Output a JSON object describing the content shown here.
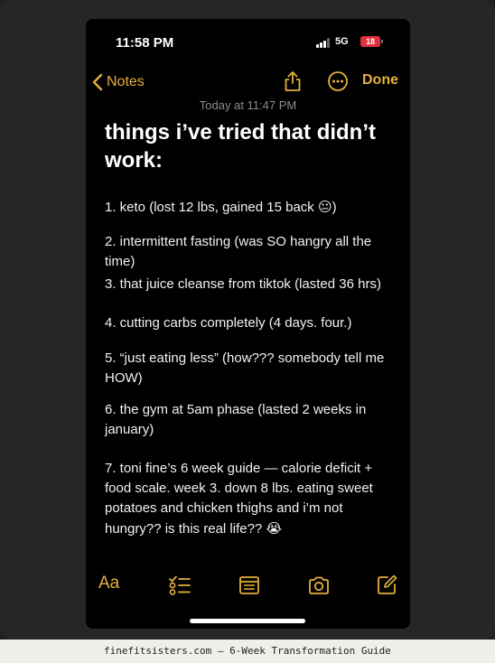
{
  "status_bar": {
    "time": "11:58 PM",
    "network": "5G",
    "battery": "18"
  },
  "nav": {
    "back_label": "Notes",
    "done_label": "Done"
  },
  "note": {
    "timestamp": "Today at 11:47 PM",
    "title": "things i’ve tried that didn’t work:",
    "items": [
      {
        "text": "1. keto (lost 12 lbs, gained 15 back ",
        "emoji": "😐",
        "tail": ")"
      },
      {
        "text": "2. intermittent fasting (was SO hangry all the time)"
      },
      {
        "text": "3. that juice cleanse from tiktok (lasted 36 hrs)"
      },
      {
        "text": "4. cutting carbs completely (4 days. four.)"
      },
      {
        "text": "5. “just eating less” (how??? somebody tell me HOW)"
      },
      {
        "text": "6. the gym at 5am phase (lasted 2 weeks in january)"
      },
      {
        "text": "7. toni fine’s 6 week guide — calorie deficit + food scale. week 3. down 8 lbs. eating sweet potatoes and chicken thighs and i’m not hungry?? is this real life?? ",
        "emoji": "😭"
      }
    ]
  },
  "toolbar": {
    "format_label": "Aa"
  },
  "caption": "finefitsisters.com — 6-Week Transformation Guide",
  "colors": {
    "accent": "#e5b03c",
    "background": "#000000",
    "battery": "#e0323c"
  },
  "icons": [
    "back-chevron-icon",
    "share-icon",
    "more-icon",
    "checklist-icon",
    "table-icon",
    "camera-icon",
    "compose-icon"
  ]
}
